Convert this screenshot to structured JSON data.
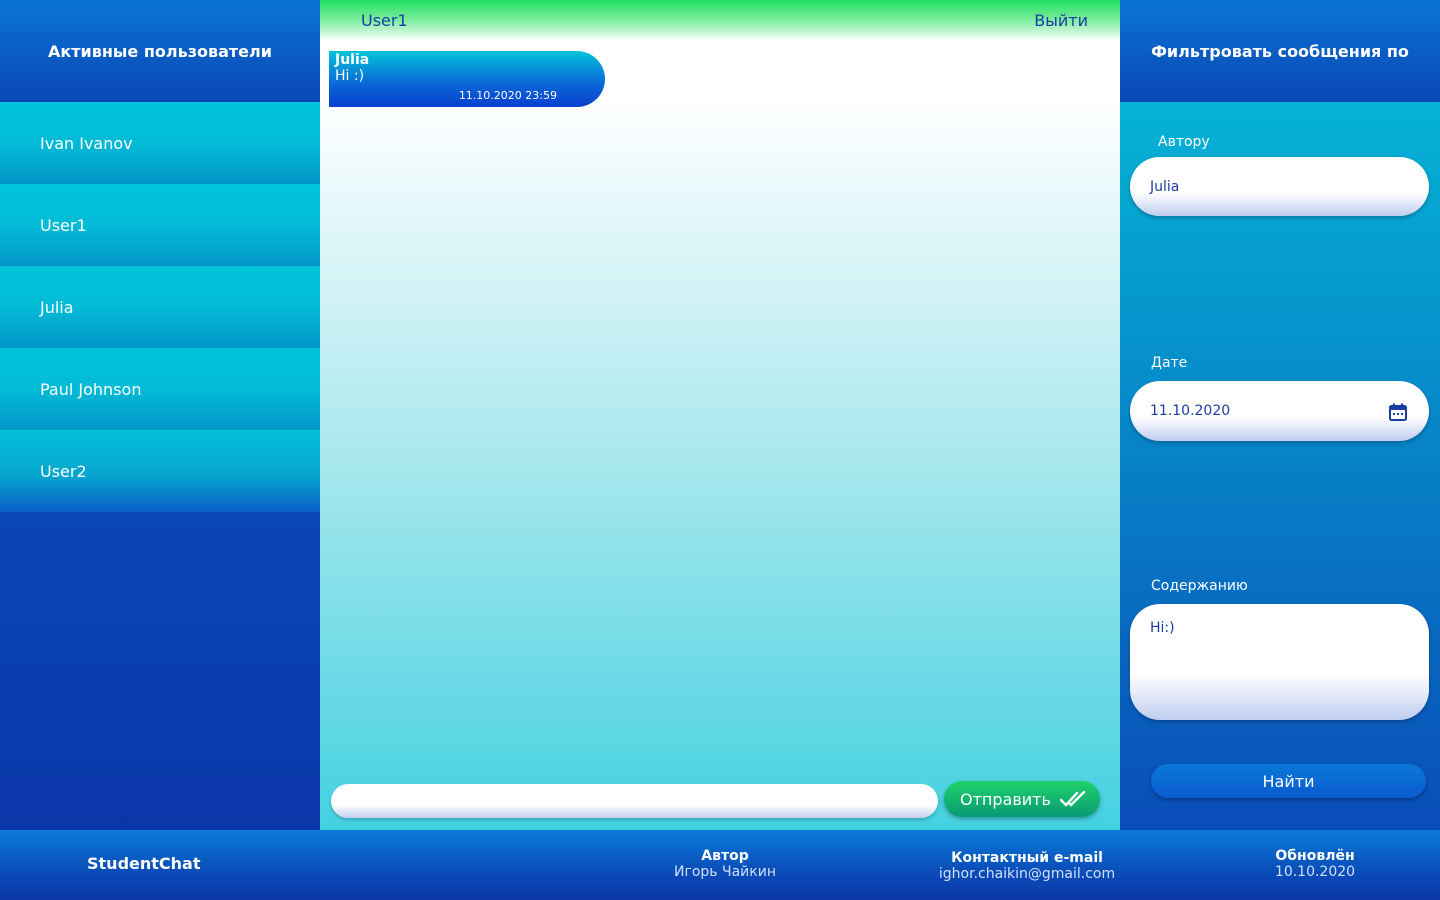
{
  "left": {
    "title": "Активные пользователи",
    "users": [
      "Ivan Ivanov",
      "User1",
      "Julia",
      "Paul Johnson",
      "User2"
    ]
  },
  "chat": {
    "current_user": "User1",
    "logout": "Выйти",
    "messages": [
      {
        "author": "Julia",
        "text": "Hi :)",
        "time": "11.10.2020 23:59"
      }
    ],
    "compose_value": "",
    "send_label": "Отправить"
  },
  "filter": {
    "title": "Фильтровать сообщения по",
    "author_label": "Автору",
    "author_value": "Julia",
    "date_label": "Дате",
    "date_value": "11.10.2020",
    "content_label": "Содержанию",
    "content_value": "Hi:)",
    "find_label": "Найти"
  },
  "footer": {
    "brand": "StudentChat",
    "author_title": "Автор",
    "author_name": "Игорь Чайкин",
    "email_title": "Контактный e-mail",
    "email": "ighor.chaikin@gmail.com",
    "updated_title": "Обновлён",
    "updated_date": "10.10.2020"
  }
}
